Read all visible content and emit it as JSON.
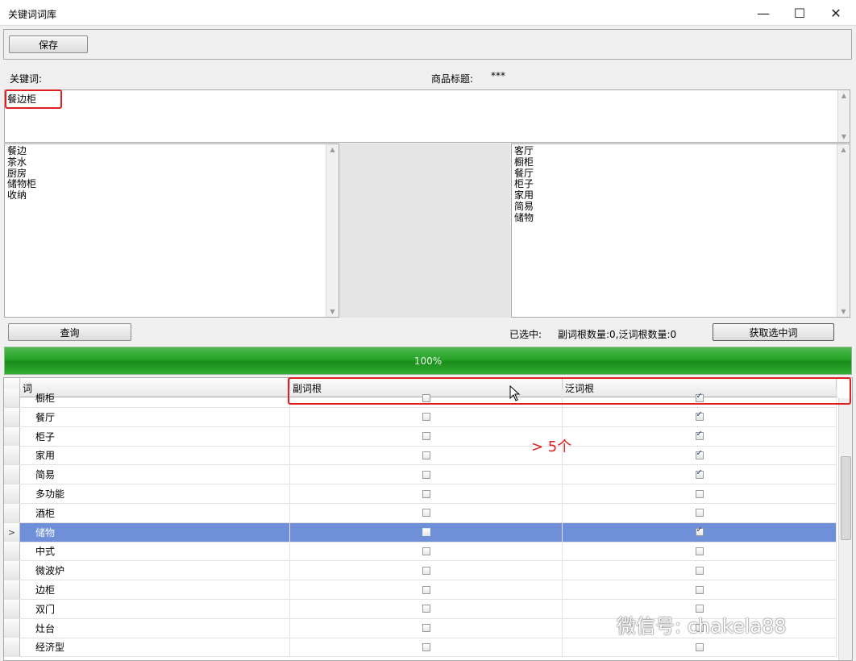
{
  "window": {
    "title": "关键词词库",
    "minimize": "—",
    "maximize": "☐",
    "close": "✕"
  },
  "toolbar": {
    "save_label": "保存"
  },
  "keyword": {
    "label": "关键词:",
    "product_title_label": "商品标题:",
    "product_title_value": "***",
    "input_text": "餐边柜"
  },
  "left_list": {
    "items": [
      "餐边",
      "茶水",
      "厨房",
      "储物柜",
      "收纳"
    ]
  },
  "right_list": {
    "items": [
      "客厅",
      "橱柜",
      "餐厅",
      "柜子",
      "家用",
      "简易",
      "储物"
    ]
  },
  "actions": {
    "query_label": "查询",
    "selected_label": "已选中:",
    "selected_counts": "副词根数量:0,泛词根数量:0",
    "get_selected_label": "获取选中词"
  },
  "progress": {
    "text": "100%",
    "value_percent": 100
  },
  "grid": {
    "columns": [
      "词",
      "副词根",
      "泛词根"
    ],
    "rows": [
      {
        "word": "橱柜",
        "sub_root": false,
        "gen_root": true
      },
      {
        "word": "餐厅",
        "sub_root": false,
        "gen_root": true
      },
      {
        "word": "柜子",
        "sub_root": false,
        "gen_root": true
      },
      {
        "word": "家用",
        "sub_root": false,
        "gen_root": true
      },
      {
        "word": "简易",
        "sub_root": false,
        "gen_root": true
      },
      {
        "word": "多功能",
        "sub_root": false,
        "gen_root": false
      },
      {
        "word": "酒柜",
        "sub_root": false,
        "gen_root": false
      },
      {
        "word": "储物",
        "sub_root": false,
        "gen_root": true,
        "selected": true,
        "indicator": ">"
      },
      {
        "word": "中式",
        "sub_root": false,
        "gen_root": false
      },
      {
        "word": "微波炉",
        "sub_root": false,
        "gen_root": false
      },
      {
        "word": "边柜",
        "sub_root": false,
        "gen_root": false
      },
      {
        "word": "双门",
        "sub_root": false,
        "gen_root": false
      },
      {
        "word": "灶台",
        "sub_root": false,
        "gen_root": false
      },
      {
        "word": "经济型",
        "sub_root": false,
        "gen_root": false
      }
    ]
  },
  "annotation": {
    "text": "> 5个"
  },
  "watermark": {
    "text": "微信号: chakela88"
  },
  "colors": {
    "selection": "#6f8fd8",
    "progress": "#27a227",
    "annotation": "#e02020"
  }
}
